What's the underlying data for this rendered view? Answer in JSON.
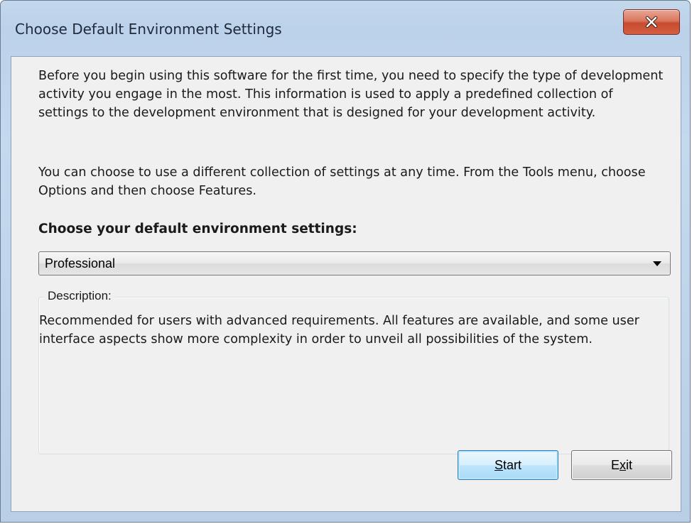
{
  "window": {
    "title": "Choose Default Environment Settings",
    "close_icon": "close-icon"
  },
  "intro": {
    "paragraph1": "Before you begin using this software for the first time, you need to specify the type of development activity you engage in the most. This information is used to apply a predefined collection of settings to the development environment that is designed for your development activity.",
    "paragraph2": "You can choose to use a different collection of settings at any time. From the Tools menu, choose Options and then choose Features."
  },
  "settings": {
    "prompt_label": "Choose your default environment settings:",
    "selected_value": "Professional",
    "dropdown_icon": "dropdown-arrow-icon"
  },
  "description": {
    "legend": "Description:",
    "text": "Recommended for users with advanced requirements. All features are available, and some user interface aspects show more complexity in order to unveil all possibilities of the system."
  },
  "buttons": {
    "start": {
      "mnemonic": "S",
      "rest": "tart"
    },
    "exit": {
      "before": "E",
      "mnemonic": "x",
      "rest": "it"
    }
  },
  "colors": {
    "default_button_border": "#3c7fb1",
    "close_button": "#c74b30"
  }
}
